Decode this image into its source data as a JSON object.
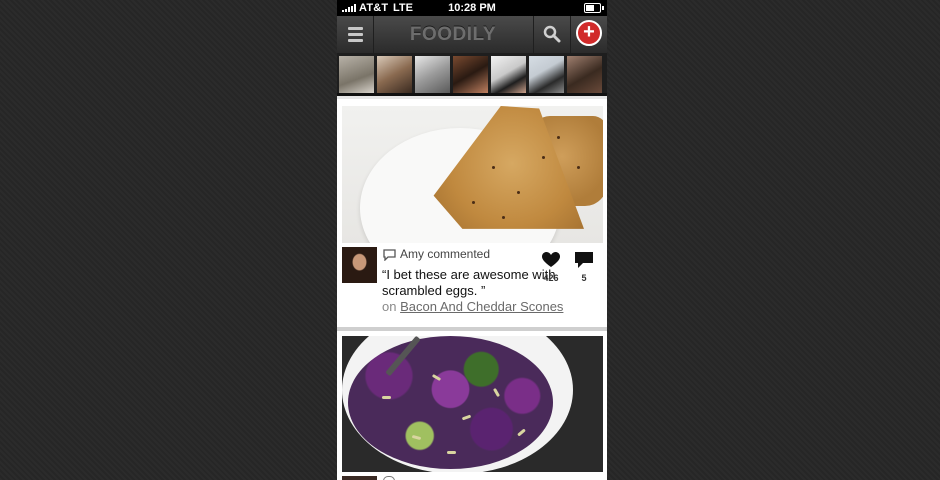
{
  "status_bar": {
    "carrier": "AT&T",
    "network": "LTE",
    "time": "10:28 PM"
  },
  "nav": {
    "logo": "FOODILY",
    "icons": [
      "menu-icon",
      "search-icon",
      "add-icon"
    ]
  },
  "avatars": [
    {
      "name": "avatar-1"
    },
    {
      "name": "avatar-2"
    },
    {
      "name": "avatar-3"
    },
    {
      "name": "avatar-4"
    },
    {
      "name": "avatar-5"
    },
    {
      "name": "avatar-6"
    },
    {
      "name": "avatar-7"
    }
  ],
  "feed": {
    "cards": [
      {
        "commenter": "Amy commented",
        "comment": "“I bet these are awesome with scrambled eggs. ”",
        "on_prefix": "on",
        "recipe": "Bacon And Cheddar Scones",
        "likes": "426",
        "comments": "5"
      }
    ]
  },
  "colors": {
    "background": "#262626",
    "navbar": "#3a3a3a",
    "accent_add": "#d12a2a",
    "link": "#6a6a6a"
  }
}
